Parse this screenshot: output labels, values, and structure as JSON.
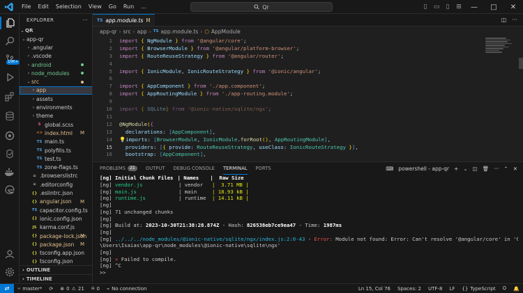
{
  "titlebar": {
    "menus": [
      "File",
      "Edit",
      "Selection",
      "View",
      "Go",
      "Run",
      "..."
    ],
    "search_text": "Qr",
    "nav_back": "←",
    "nav_forward": "→"
  },
  "activity": {
    "extensions_badge": "10K+"
  },
  "sidebar": {
    "title": "EXPLORER",
    "root": "QR",
    "items": [
      {
        "label": "app-qr",
        "type": "folder",
        "open": true,
        "color": "#cccccc"
      },
      {
        "label": ".angular",
        "type": "folder",
        "color": "#cccccc"
      },
      {
        "label": ".vscode",
        "type": "folder",
        "color": "#cccccc"
      },
      {
        "label": "android",
        "type": "folder",
        "color": "#73c991",
        "dot": true
      },
      {
        "label": "node_modules",
        "type": "folder",
        "color": "#73c991",
        "dot": true
      },
      {
        "label": "src",
        "type": "folder",
        "open": true,
        "color": "#e2c08d",
        "dot": true
      },
      {
        "label": "app",
        "type": "folder",
        "color": "#e2c08d",
        "selected": true
      },
      {
        "label": "assets",
        "type": "folder",
        "color": "#cccccc"
      },
      {
        "label": "environments",
        "type": "folder",
        "color": "#cccccc"
      },
      {
        "label": "theme",
        "type": "folder",
        "color": "#cccccc"
      },
      {
        "label": "global.scss",
        "type": "scss",
        "color": "#cccccc"
      },
      {
        "label": "index.html",
        "type": "html",
        "color": "#e2c08d",
        "badge": "M"
      },
      {
        "label": "main.ts",
        "type": "ts",
        "color": "#cccccc"
      },
      {
        "label": "polyfills.ts",
        "type": "ts",
        "color": "#cccccc"
      },
      {
        "label": "test.ts",
        "type": "ts",
        "color": "#cccccc"
      },
      {
        "label": "zone-flags.ts",
        "type": "ts",
        "color": "#cccccc"
      },
      {
        "label": ".browserslistrc",
        "type": "cfg",
        "color": "#cccccc"
      },
      {
        "label": ".editorconfig",
        "type": "cfg",
        "color": "#cccccc"
      },
      {
        "label": ".eslintrc.json",
        "type": "json",
        "color": "#cccccc"
      },
      {
        "label": "angular.json",
        "type": "json",
        "color": "#e2c08d",
        "badge": "M"
      },
      {
        "label": "capacitor.config.ts",
        "type": "ts",
        "color": "#cccccc"
      },
      {
        "label": "ionic.config.json",
        "type": "json",
        "color": "#cccccc"
      },
      {
        "label": "karma.conf.js",
        "type": "js",
        "color": "#cccccc"
      },
      {
        "label": "package-lock.json",
        "type": "json",
        "color": "#e2c08d",
        "badge": "M"
      },
      {
        "label": "package.json",
        "type": "json",
        "color": "#e2c08d",
        "badge": "M"
      },
      {
        "label": "tsconfig.app.json",
        "type": "json",
        "color": "#cccccc"
      },
      {
        "label": "tsconfig.json",
        "type": "json",
        "color": "#cccccc"
      }
    ],
    "outline_label": "OUTLINE",
    "timeline_label": "TIMELINE"
  },
  "editor": {
    "tab": {
      "label": "app.module.ts",
      "modified": "M",
      "icon": "TS"
    },
    "breadcrumb": [
      "app-qr",
      "src",
      "app",
      "app.module.ts",
      "AppModule"
    ],
    "current_line": 15,
    "lines": [
      "1",
      "2",
      "3",
      "4",
      "5",
      "6",
      "7",
      "8",
      "9",
      "10",
      "11",
      "12",
      "13",
      "14",
      "15",
      "16"
    ]
  },
  "panel": {
    "tabs": [
      "PROBLEMS",
      "OUTPUT",
      "DEBUG CONSOLE",
      "TERMINAL",
      "PORTS"
    ],
    "problems_count": "21",
    "active_tab": "TERMINAL",
    "terminal_name": "powershell - app-qr",
    "terminal": {
      "header": [
        "[ng] Initial Chunk Files",
        "| Names",
        "|  Raw Size"
      ],
      "chunks": [
        {
          "prefix": "[ng] ",
          "file": "vendor.js",
          "name": "| vendor",
          "size": "|  3.71 MB |"
        },
        {
          "prefix": "[ng] ",
          "file": "main.js",
          "name": "| main",
          "size": "| 18.93 kB |"
        },
        {
          "prefix": "[ng] ",
          "file": "runtime.js",
          "name": "| runtime",
          "size": "| 14.11 kB |"
        }
      ],
      "blank": "[ng]",
      "unchanged": "[ng] 71 unchanged chunks",
      "build_prefix": "[ng] Build at: ",
      "build_time": "2023-10-30T21:38:28.874Z",
      "build_hash_label": " - Hash: ",
      "build_hash": "826538eb7ce9ea47",
      "build_time_label": " - Time: ",
      "build_duration": "1987ms",
      "error_prefix": "[ng] ",
      "error_path": "../../../node_modules/@ionic-native/sqlite/ngx/index.js:2:0-43",
      "error_sep": " - ",
      "error_word": "Error:",
      "error_msg": " Module not found: Error: Can't resolve '@angular/core' in 'C:",
      "error_msg2": "\\Users\\Isaias\\app-qr\\node_modules\\@ionic-native\\sqlite\\ngx'",
      "fail_prefix": "[ng] ",
      "fail_mark": "×",
      "fail_text": " Failed to compile.",
      "ctrlc": "[ng] ^C",
      "prompt": ">>"
    }
  },
  "statusbar": {
    "branch": "master*",
    "errors": "0",
    "warnings": "21",
    "ports": "0",
    "connection": "No connection",
    "position": "Ln 15, Col 76",
    "spaces": "Spaces: 2",
    "encoding": "UTF-8",
    "eol": "LF",
    "language": "TypeScript"
  }
}
